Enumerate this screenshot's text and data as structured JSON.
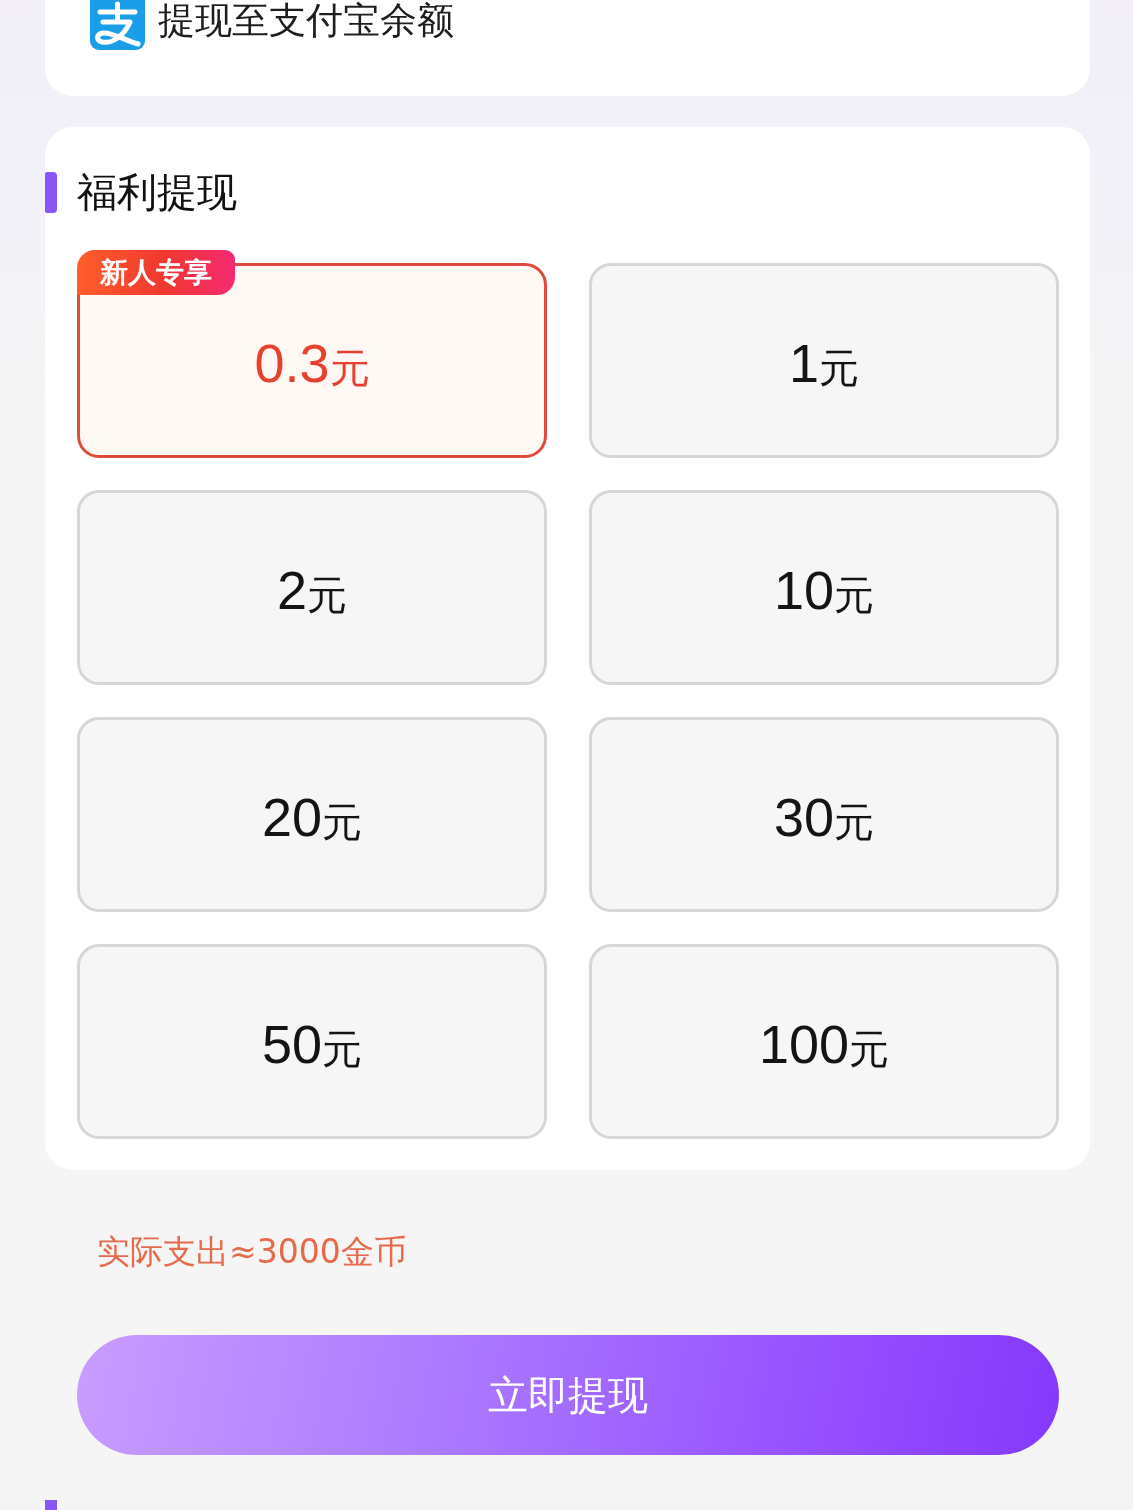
{
  "account": {
    "title": "提现至支付宝余额"
  },
  "withdraw": {
    "title": "福利提现",
    "options": [
      {
        "amount": "0.3",
        "unit": "元",
        "selected": true,
        "badge": "新人专享"
      },
      {
        "amount": "1",
        "unit": "元",
        "selected": false
      },
      {
        "amount": "2",
        "unit": "元",
        "selected": false
      },
      {
        "amount": "10",
        "unit": "元",
        "selected": false
      },
      {
        "amount": "20",
        "unit": "元",
        "selected": false
      },
      {
        "amount": "30",
        "unit": "元",
        "selected": false
      },
      {
        "amount": "50",
        "unit": "元",
        "selected": false
      },
      {
        "amount": "100",
        "unit": "元",
        "selected": false
      }
    ]
  },
  "cost_note": "实际支出≈3000金币",
  "submit_button": "立即提现"
}
